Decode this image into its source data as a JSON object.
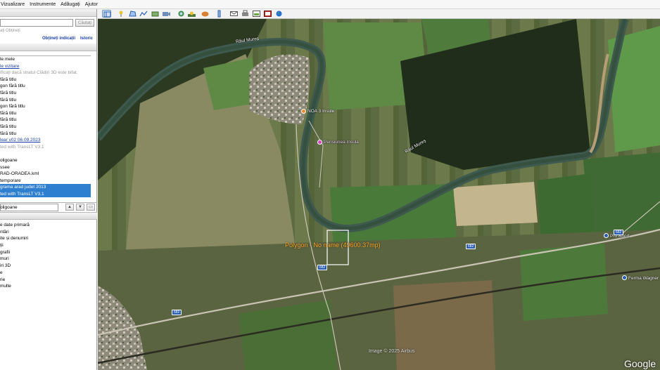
{
  "menubar": {
    "items": [
      "Vizualizare",
      "Instrumente",
      "Adăugați",
      "Ajutor"
    ]
  },
  "search": {
    "button_label": "Căutați",
    "hint": "ați Obțineți",
    "link_directions": "Obțineți indicații",
    "link_history": "Istoric"
  },
  "places": {
    "rows": [
      {
        "text": "le mele",
        "style": "normal"
      },
      {
        "text": "le vizitare",
        "style": "blue"
      },
      {
        "text": "ificați dacă stratul Clădiri 3D este bifat.",
        "style": "grey"
      },
      {
        "text": "fără titlu",
        "style": "normal"
      },
      {
        "text": "gon fără titlu",
        "style": "normal"
      },
      {
        "text": "fără titlu",
        "style": "normal"
      },
      {
        "text": "fără titlu",
        "style": "normal"
      },
      {
        "text": "gon fără titlu",
        "style": "normal"
      },
      {
        "text": "fără titlu",
        "style": "normal"
      },
      {
        "text": "fără titlu",
        "style": "normal"
      },
      {
        "text": "fără titlu",
        "style": "normal"
      },
      {
        "text": "fără titlu",
        "style": "normal"
      },
      {
        "text": "lear v02 06.09.2023",
        "style": "blue"
      },
      {
        "text": "ted with TransLT V3.1",
        "style": "grey"
      },
      {
        "text": "",
        "style": "normal"
      },
      {
        "text": "oligoane",
        "style": "normal"
      },
      {
        "text": "ssee",
        "style": "normal"
      },
      {
        "text": "RAD-ORADEA.kml",
        "style": "normal"
      },
      {
        "text": "temporare",
        "style": "normal"
      },
      {
        "text": "grama arad judet 2013",
        "style": "sel"
      },
      {
        "text": "ted with TransLT V3.1",
        "style": "sel"
      }
    ],
    "footer": "oligoane"
  },
  "layers": {
    "rows": [
      "e date primară",
      "ntări",
      "ite și denumiri",
      "ții",
      "grafii",
      "muri",
      "iri 3D",
      "e",
      "rie",
      "multe"
    ]
  },
  "map": {
    "labels": {
      "river1": "Râul Mureș",
      "river2": "Râul Mureș",
      "noa": "NOA 3 Insule",
      "pension": "Pensiunea Insula",
      "sport": "Pro Sport",
      "ferma": "Ferma Wagner"
    },
    "polygon_label": "Polygon - No name (49600.37mp)",
    "road_badges": [
      "682",
      "682",
      "682",
      "682"
    ],
    "copyright": "Image © 2025 Airbus",
    "brand": "Google"
  },
  "colors": {
    "selection": "#2f7fd0",
    "link": "#1a3ea8",
    "polygon_label": "#f5a623",
    "river": "#3e5a4f",
    "road_badge": "#2a5db0"
  }
}
